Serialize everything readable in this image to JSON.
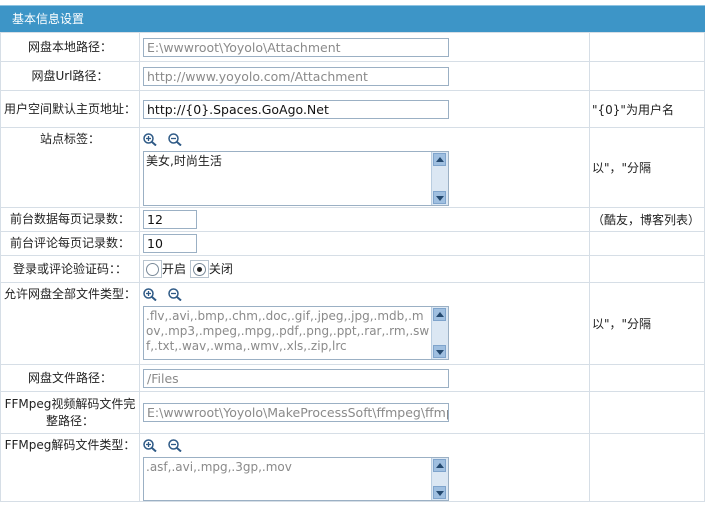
{
  "header": {
    "title": "基本信息设置"
  },
  "rows": {
    "local_path": {
      "label": "网盘本地路径：",
      "value": "E:\\wwwroot\\Yoyolo\\Attachment"
    },
    "url_path": {
      "label": "网盘Url路径：",
      "value": "http://www.yoyolo.com/Attachment"
    },
    "user_space": {
      "label": "用户空间默认主页地址：",
      "value": "http://{0}.Spaces.GoAgo.Net",
      "note": "\"{0}\"为用户名"
    },
    "site_tags": {
      "label": "站点标签：",
      "value": "美女,时尚生活",
      "note": "以\"，\"分隔"
    },
    "front_page_size": {
      "label": "前台数据每页记录数：",
      "value": "12",
      "note": "（酷友，博客列表）"
    },
    "comment_page_size": {
      "label": "前台评论每页记录数：",
      "value": "10"
    },
    "captcha": {
      "label": "登录或评论验证码：：",
      "option_on": "开启",
      "option_off": "关闭",
      "selected": "关闭"
    },
    "allowed_types": {
      "label": "允许网盘全部文件类型：",
      "value": ".flv,.avi,.bmp,.chm,.doc,.gif,.jpeg,.jpg,.mdb,.mov,.mp3,.mpeg,.mpg,.pdf,.png,.ppt,.rar,.rm,.swf,.txt,.wav,.wma,.wmv,.xls,.zip,lrc",
      "note": "以\"，\"分隔"
    },
    "file_path": {
      "label": "网盘文件路径：",
      "value": "/Files"
    },
    "ffmpeg_path": {
      "label": "FFMpeg视频解码文件完整路径：",
      "value": "E:\\wwwroot\\Yoyolo\\MakeProcessSoft\\ffmpeg\\ffmpeg.exe"
    },
    "ffmpeg_types": {
      "label": "FFMpeg解码文件类型：",
      "value": ".asf,.avi,.mpg,.3gp,.mov"
    }
  }
}
